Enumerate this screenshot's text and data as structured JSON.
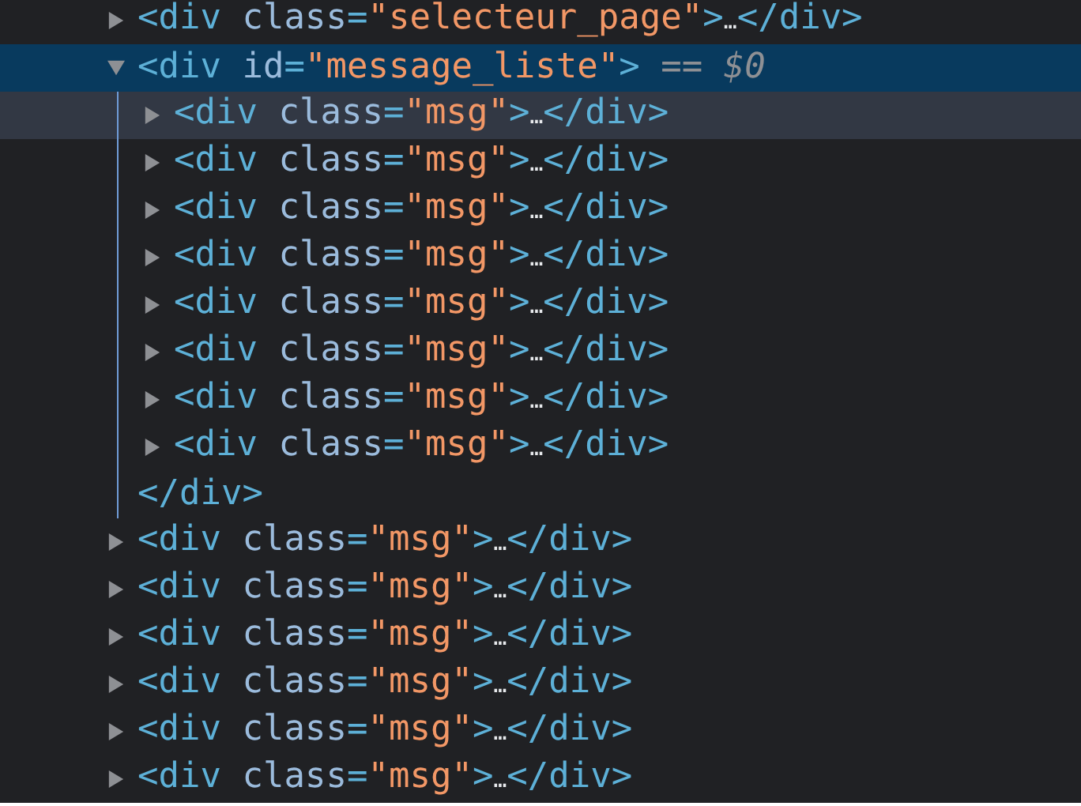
{
  "elements_panel": {
    "nodes": [
      {
        "expanded": false,
        "selected": false,
        "hovered": false,
        "tokens": [
          {
            "kind": "tag",
            "text": "<div"
          },
          {
            "kind": "attr_name",
            "text": " class"
          },
          {
            "kind": "tag",
            "text": "="
          },
          {
            "kind": "attr_value",
            "text": "\"selecteur_page\""
          },
          {
            "kind": "tag",
            "text": ">"
          },
          {
            "kind": "ellipsis",
            "text": "…"
          },
          {
            "kind": "tag",
            "text": "</div>"
          }
        ]
      },
      {
        "expanded": true,
        "selected": true,
        "hovered": false,
        "tokens": [
          {
            "kind": "tag",
            "text": "<div"
          },
          {
            "kind": "attr_name",
            "text": " id"
          },
          {
            "kind": "tag",
            "text": "="
          },
          {
            "kind": "attr_value",
            "text": "\"message_liste\""
          },
          {
            "kind": "tag",
            "text": ">"
          },
          {
            "kind": "console_ref",
            "text": " == $0"
          }
        ],
        "children": [
          {
            "expanded": false,
            "selected": false,
            "hovered": true,
            "tokens": [
              {
                "kind": "tag",
                "text": "<div"
              },
              {
                "kind": "attr_name",
                "text": " class"
              },
              {
                "kind": "tag",
                "text": "="
              },
              {
                "kind": "attr_value",
                "text": "\"msg\""
              },
              {
                "kind": "tag",
                "text": ">"
              },
              {
                "kind": "ellipsis",
                "text": "…"
              },
              {
                "kind": "tag",
                "text": "</div>"
              }
            ]
          },
          {
            "expanded": false,
            "selected": false,
            "hovered": false,
            "tokens": [
              {
                "kind": "tag",
                "text": "<div"
              },
              {
                "kind": "attr_name",
                "text": " class"
              },
              {
                "kind": "tag",
                "text": "="
              },
              {
                "kind": "attr_value",
                "text": "\"msg\""
              },
              {
                "kind": "tag",
                "text": ">"
              },
              {
                "kind": "ellipsis",
                "text": "…"
              },
              {
                "kind": "tag",
                "text": "</div>"
              }
            ]
          },
          {
            "expanded": false,
            "selected": false,
            "hovered": false,
            "tokens": [
              {
                "kind": "tag",
                "text": "<div"
              },
              {
                "kind": "attr_name",
                "text": " class"
              },
              {
                "kind": "tag",
                "text": "="
              },
              {
                "kind": "attr_value",
                "text": "\"msg\""
              },
              {
                "kind": "tag",
                "text": ">"
              },
              {
                "kind": "ellipsis",
                "text": "…"
              },
              {
                "kind": "tag",
                "text": "</div>"
              }
            ]
          },
          {
            "expanded": false,
            "selected": false,
            "hovered": false,
            "tokens": [
              {
                "kind": "tag",
                "text": "<div"
              },
              {
                "kind": "attr_name",
                "text": " class"
              },
              {
                "kind": "tag",
                "text": "="
              },
              {
                "kind": "attr_value",
                "text": "\"msg\""
              },
              {
                "kind": "tag",
                "text": ">"
              },
              {
                "kind": "ellipsis",
                "text": "…"
              },
              {
                "kind": "tag",
                "text": "</div>"
              }
            ]
          },
          {
            "expanded": false,
            "selected": false,
            "hovered": false,
            "tokens": [
              {
                "kind": "tag",
                "text": "<div"
              },
              {
                "kind": "attr_name",
                "text": " class"
              },
              {
                "kind": "tag",
                "text": "="
              },
              {
                "kind": "attr_value",
                "text": "\"msg\""
              },
              {
                "kind": "tag",
                "text": ">"
              },
              {
                "kind": "ellipsis",
                "text": "…"
              },
              {
                "kind": "tag",
                "text": "</div>"
              }
            ]
          },
          {
            "expanded": false,
            "selected": false,
            "hovered": false,
            "tokens": [
              {
                "kind": "tag",
                "text": "<div"
              },
              {
                "kind": "attr_name",
                "text": " class"
              },
              {
                "kind": "tag",
                "text": "="
              },
              {
                "kind": "attr_value",
                "text": "\"msg\""
              },
              {
                "kind": "tag",
                "text": ">"
              },
              {
                "kind": "ellipsis",
                "text": "…"
              },
              {
                "kind": "tag",
                "text": "</div>"
              }
            ]
          },
          {
            "expanded": false,
            "selected": false,
            "hovered": false,
            "tokens": [
              {
                "kind": "tag",
                "text": "<div"
              },
              {
                "kind": "attr_name",
                "text": " class"
              },
              {
                "kind": "tag",
                "text": "="
              },
              {
                "kind": "attr_value",
                "text": "\"msg\""
              },
              {
                "kind": "tag",
                "text": ">"
              },
              {
                "kind": "ellipsis",
                "text": "…"
              },
              {
                "kind": "tag",
                "text": "</div>"
              }
            ]
          },
          {
            "expanded": false,
            "selected": false,
            "hovered": false,
            "tokens": [
              {
                "kind": "tag",
                "text": "<div"
              },
              {
                "kind": "attr_name",
                "text": " class"
              },
              {
                "kind": "tag",
                "text": "="
              },
              {
                "kind": "attr_value",
                "text": "\"msg\""
              },
              {
                "kind": "tag",
                "text": ">"
              },
              {
                "kind": "ellipsis",
                "text": "…"
              },
              {
                "kind": "tag",
                "text": "</div>"
              }
            ]
          }
        ],
        "closing_tokens": [
          {
            "kind": "tag",
            "text": "</div>"
          }
        ]
      },
      {
        "expanded": false,
        "selected": false,
        "hovered": false,
        "tokens": [
          {
            "kind": "tag",
            "text": "<div"
          },
          {
            "kind": "attr_name",
            "text": " class"
          },
          {
            "kind": "tag",
            "text": "="
          },
          {
            "kind": "attr_value",
            "text": "\"msg\""
          },
          {
            "kind": "tag",
            "text": ">"
          },
          {
            "kind": "ellipsis",
            "text": "…"
          },
          {
            "kind": "tag",
            "text": "</div>"
          }
        ]
      },
      {
        "expanded": false,
        "selected": false,
        "hovered": false,
        "tokens": [
          {
            "kind": "tag",
            "text": "<div"
          },
          {
            "kind": "attr_name",
            "text": " class"
          },
          {
            "kind": "tag",
            "text": "="
          },
          {
            "kind": "attr_value",
            "text": "\"msg\""
          },
          {
            "kind": "tag",
            "text": ">"
          },
          {
            "kind": "ellipsis",
            "text": "…"
          },
          {
            "kind": "tag",
            "text": "</div>"
          }
        ]
      },
      {
        "expanded": false,
        "selected": false,
        "hovered": false,
        "tokens": [
          {
            "kind": "tag",
            "text": "<div"
          },
          {
            "kind": "attr_name",
            "text": " class"
          },
          {
            "kind": "tag",
            "text": "="
          },
          {
            "kind": "attr_value",
            "text": "\"msg\""
          },
          {
            "kind": "tag",
            "text": ">"
          },
          {
            "kind": "ellipsis",
            "text": "…"
          },
          {
            "kind": "tag",
            "text": "</div>"
          }
        ]
      },
      {
        "expanded": false,
        "selected": false,
        "hovered": false,
        "tokens": [
          {
            "kind": "tag",
            "text": "<div"
          },
          {
            "kind": "attr_name",
            "text": " class"
          },
          {
            "kind": "tag",
            "text": "="
          },
          {
            "kind": "attr_value",
            "text": "\"msg\""
          },
          {
            "kind": "tag",
            "text": ">"
          },
          {
            "kind": "ellipsis",
            "text": "…"
          },
          {
            "kind": "tag",
            "text": "</div>"
          }
        ]
      },
      {
        "expanded": false,
        "selected": false,
        "hovered": false,
        "tokens": [
          {
            "kind": "tag",
            "text": "<div"
          },
          {
            "kind": "attr_name",
            "text": " class"
          },
          {
            "kind": "tag",
            "text": "="
          },
          {
            "kind": "attr_value",
            "text": "\"msg\""
          },
          {
            "kind": "tag",
            "text": ">"
          },
          {
            "kind": "ellipsis",
            "text": "…"
          },
          {
            "kind": "tag",
            "text": "</div>"
          }
        ]
      },
      {
        "expanded": false,
        "selected": false,
        "hovered": false,
        "tokens": [
          {
            "kind": "tag",
            "text": "<div"
          },
          {
            "kind": "attr_name",
            "text": " class"
          },
          {
            "kind": "tag",
            "text": "="
          },
          {
            "kind": "attr_value",
            "text": "\"msg\""
          },
          {
            "kind": "tag",
            "text": ">"
          },
          {
            "kind": "ellipsis",
            "text": "…"
          },
          {
            "kind": "tag",
            "text": "</div>"
          }
        ]
      }
    ]
  }
}
